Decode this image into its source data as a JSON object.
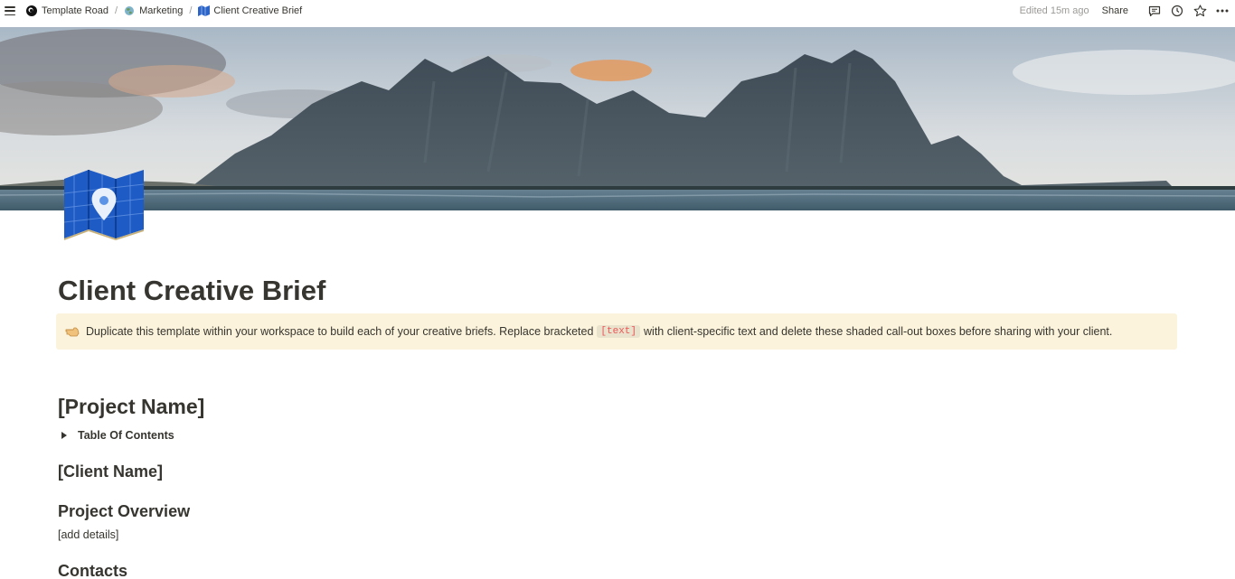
{
  "topbar": {
    "breadcrumbs": [
      {
        "label": "Template Road",
        "icon": "workspace-logo-icon"
      },
      {
        "label": "Marketing",
        "icon": "globe-icon"
      },
      {
        "label": "Client Creative Brief",
        "icon": "map-icon"
      }
    ],
    "separator": "/",
    "edited": "Edited 15m ago",
    "share_label": "Share",
    "tools": [
      "comment-icon",
      "history-icon",
      "favorite-star-icon",
      "more-icon"
    ]
  },
  "page": {
    "title": "Client Creative Brief",
    "cover": "mountain-landscape",
    "icon": "map-pin-icon",
    "callout": {
      "emoji": "pointing-hand-icon",
      "text_before": "Duplicate this template within your workspace to build each of your creative briefs. Replace bracketed",
      "code": "[text]",
      "text_after": "with client-specific text and delete these shaded call-out boxes before sharing with your client."
    },
    "project_name": "[Project Name]",
    "toc_label": "Table Of Contents",
    "client_name": "[Client Name]",
    "overview_heading": "Project Overview",
    "overview_text": "[add details]",
    "contacts_heading": "Contacts"
  },
  "colors": {
    "text": "#37352f",
    "muted": "#9b9a97",
    "callout_bg": "#fbf3db",
    "code_red": "#eb5757"
  }
}
